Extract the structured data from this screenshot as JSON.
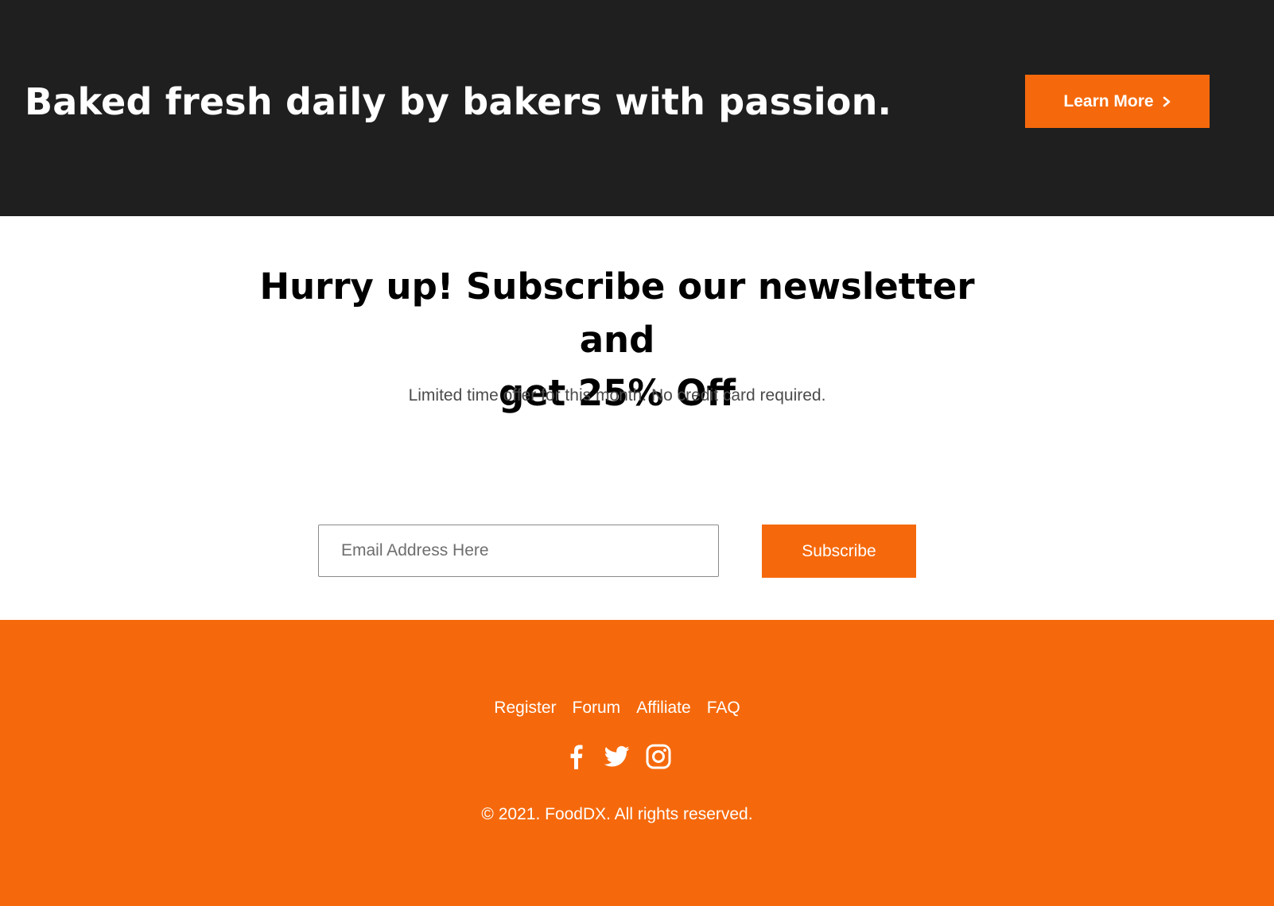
{
  "hero": {
    "title": "Baked fresh daily by bakers with passion.",
    "cta_label": "Learn More",
    "cta_icon": "chevron-right-icon"
  },
  "newsletter": {
    "heading_line1": "Hurry up! Subscribe our newsletter and",
    "heading_line2": "get 25% Off",
    "subtext": "Limited time offer for this month. No credit card required.",
    "email_placeholder": "Email Address Here",
    "email_value": "",
    "subscribe_label": "Subscribe"
  },
  "footer": {
    "links": [
      "Register",
      "Forum",
      "Affiliate",
      "FAQ"
    ],
    "socials": [
      "facebook-icon",
      "twitter-icon",
      "instagram-icon"
    ],
    "copyright": "© 2021. FoodDX. All rights reserved."
  },
  "colors": {
    "hero_background": "#1f1f1f",
    "accent": "#f5690c",
    "text_light": "#ffffff",
    "text_dark": "#000000",
    "text_muted": "#4b4b4b"
  }
}
